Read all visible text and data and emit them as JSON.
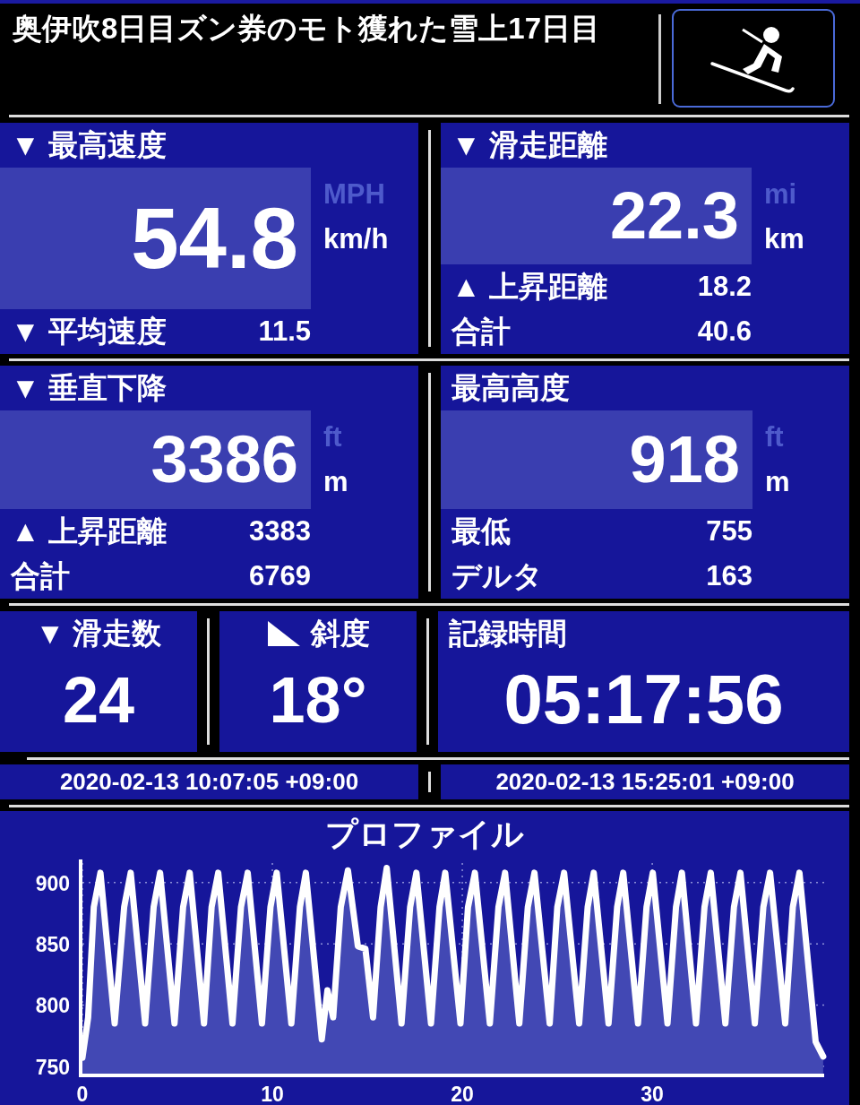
{
  "header": {
    "title": "奥伊吹8日目ズン券のモト獲れた雪上17日目"
  },
  "stats": [
    {
      "title": "▼ 最高速度",
      "value": "54.8",
      "units": [
        {
          "label": "MPH",
          "selected": false
        },
        {
          "label": "km/h",
          "selected": true
        }
      ],
      "rows": [
        {
          "label": "▼ 平均速度",
          "value": "11.5"
        }
      ]
    },
    {
      "title": "▼ 滑走距離",
      "value": "22.3",
      "units": [
        {
          "label": "mi",
          "selected": false
        },
        {
          "label": "km",
          "selected": true
        }
      ],
      "rows": [
        {
          "label": "▲ 上昇距離",
          "value": "18.2"
        },
        {
          "label": "合計",
          "value": "40.6"
        }
      ]
    },
    {
      "title": "▼ 垂直下降",
      "value": "3386",
      "units": [
        {
          "label": "ft",
          "selected": false
        },
        {
          "label": "m",
          "selected": true
        }
      ],
      "rows": [
        {
          "label": "▲ 上昇距離",
          "value": "3383"
        },
        {
          "label": "合計",
          "value": "6769"
        }
      ]
    },
    {
      "title": "最高高度",
      "value": "918",
      "units": [
        {
          "label": "ft",
          "selected": false
        },
        {
          "label": "m",
          "selected": true
        }
      ],
      "rows": [
        {
          "label": "最低",
          "value": "755"
        },
        {
          "label": "デルタ",
          "value": "163"
        }
      ]
    }
  ],
  "counters": [
    {
      "kind": "count",
      "title": "▼ 滑走数",
      "value": "24"
    },
    {
      "kind": "slope",
      "title": "斜度",
      "value": "18°"
    },
    {
      "kind": "time",
      "title": "記録時間",
      "value": "05:17:56"
    }
  ],
  "times": [
    "2020-02-13 10:07:05 +09:00",
    "2020-02-13 15:25:01 +09:00"
  ],
  "profile": {
    "title": "プロファイル",
    "chart_data": {
      "type": "area",
      "grid": true,
      "xlim": [
        0,
        39.05
      ],
      "ylim": [
        744,
        916
      ],
      "xticks": [
        0,
        10,
        20,
        30
      ],
      "yticks": [
        750,
        800,
        850,
        900
      ],
      "x": [
        0,
        0.3,
        0.6,
        0.95,
        1.7,
        2.2,
        2.54,
        3.3,
        3.75,
        4.09,
        4.85,
        5.3,
        5.65,
        6.4,
        6.8,
        7.15,
        7.9,
        8.35,
        8.7,
        9.45,
        9.9,
        10.23,
        11.0,
        11.45,
        11.76,
        12.6,
        12.9,
        13.2,
        13.6,
        13.98,
        14.5,
        14.9,
        15.3,
        15.7,
        16.02,
        16.8,
        17.25,
        17.58,
        18.35,
        18.8,
        19.1,
        19.9,
        20.3,
        20.66,
        21.45,
        21.9,
        22.25,
        23.0,
        23.45,
        23.8,
        24.6,
        25.0,
        25.36,
        26.15,
        26.6,
        26.92,
        27.7,
        28.15,
        28.47,
        29.25,
        29.7,
        30.03,
        30.8,
        31.25,
        31.56,
        32.3,
        32.75,
        33.08,
        33.85,
        34.3,
        34.64,
        35.4,
        35.85,
        36.2,
        37.0,
        37.4,
        37.75,
        38.6,
        39
      ],
      "series": [
        {
          "color": "#ffffff",
          "values": [
            757,
            790,
            880,
            908,
            785,
            880,
            908,
            785,
            880,
            908,
            785,
            880,
            908,
            785,
            880,
            908,
            785,
            880,
            908,
            785,
            880,
            908,
            785,
            880,
            908,
            772,
            812,
            790,
            880,
            910,
            848,
            846,
            790,
            880,
            912,
            785,
            880,
            908,
            785,
            880,
            908,
            785,
            880,
            908,
            785,
            880,
            908,
            785,
            880,
            908,
            785,
            880,
            908,
            785,
            880,
            908,
            785,
            880,
            908,
            785,
            880,
            908,
            785,
            880,
            908,
            785,
            880,
            908,
            785,
            880,
            908,
            785,
            880,
            908,
            785,
            880,
            908,
            770,
            758
          ]
        }
      ]
    }
  }
}
